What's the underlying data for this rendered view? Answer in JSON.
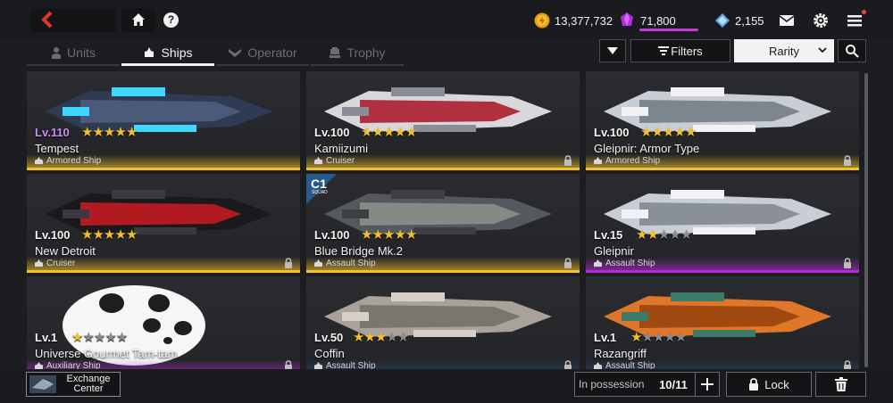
{
  "topbar": {
    "resources": {
      "credits": "13,377,732",
      "crystals": "71,800",
      "diamonds": "2,155"
    },
    "icons": [
      "back-icon",
      "home-icon",
      "help-icon",
      "credits-coin-icon",
      "crystal-icon",
      "diamond-icon",
      "mail-icon",
      "settings-gear-icon",
      "menu-icon"
    ],
    "help_label": "?"
  },
  "tabs": [
    {
      "label": "Units",
      "active": false
    },
    {
      "label": "Ships",
      "active": true
    },
    {
      "label": "Operator",
      "active": false
    },
    {
      "label": "Trophy",
      "active": false
    }
  ],
  "toolbar": {
    "filters_label": "Filters",
    "sort_value": "Rarity"
  },
  "ships": [
    {
      "level": "Lv.110",
      "stars": 5,
      "max_stars": 5,
      "name": "Tempest",
      "type": "Armored Ship",
      "rarity": "gold",
      "locked": false
    },
    {
      "level": "Lv.100",
      "stars": 5,
      "max_stars": 5,
      "name": "Kamiizumi",
      "type": "Cruiser",
      "rarity": "gold",
      "locked": true
    },
    {
      "level": "Lv.100",
      "stars": 5,
      "max_stars": 5,
      "name": "Gleipnir: Armor Type",
      "type": "Armored Ship",
      "rarity": "gold",
      "locked": true
    },
    {
      "level": "Lv.100",
      "stars": 5,
      "max_stars": 5,
      "name": "New Detroit",
      "type": "Cruiser",
      "rarity": "gold",
      "locked": true
    },
    {
      "level": "Lv.100",
      "stars": 5,
      "max_stars": 5,
      "name": "Blue Bridge Mk.2",
      "type": "Assault Ship",
      "rarity": "gold",
      "locked": true,
      "squad_badge": "C1",
      "squad_sub": "SQUAD"
    },
    {
      "level": "Lv.15",
      "stars": 2,
      "max_stars": 5,
      "name": "Gleipnir",
      "type": "Assault Ship",
      "rarity": "purple",
      "locked": true
    },
    {
      "level": "Lv.1",
      "stars": 1,
      "max_stars": 5,
      "name": "Universe Gourmet Tam-tam",
      "type": "Auxiliary Ship",
      "rarity": "purple",
      "locked": true
    },
    {
      "level": "Lv.50",
      "stars": 3,
      "max_stars": 5,
      "name": "Coffin",
      "type": "Assault Ship",
      "rarity": "blue",
      "locked": true
    },
    {
      "level": "Lv.1",
      "stars": 1,
      "max_stars": 5,
      "name": "Razangriff",
      "type": "Assault Ship",
      "rarity": "blue",
      "locked": true
    }
  ],
  "bottombar": {
    "exchange_label": "Exchange Center",
    "possession_label": "In possession",
    "possession_count": "10/11",
    "lock_label": "Lock"
  },
  "colors": {
    "gold": "#f2c02c",
    "purple": "#b52ad2",
    "blue": "#1f5f9c",
    "back_red": "#e0362c",
    "crystal_bar": "#c63ad4"
  }
}
